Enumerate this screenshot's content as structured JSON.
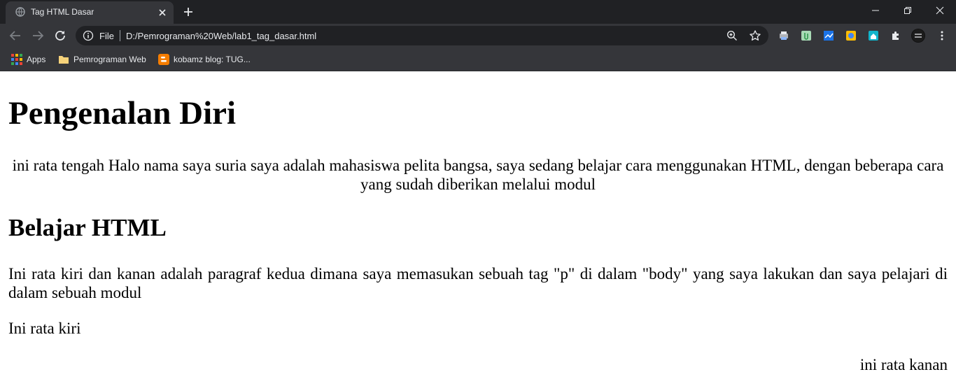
{
  "browser": {
    "tab": {
      "title": "Tag HTML Dasar"
    },
    "omnibox": {
      "scheme_label": "File",
      "url": "D:/Pemrograman%20Web/lab1_tag_dasar.html"
    },
    "bookmarks": [
      {
        "label": "Apps",
        "icon": "apps-grid-icon"
      },
      {
        "label": "Pemrograman Web",
        "icon": "folder-icon"
      },
      {
        "label": "kobamz blog: TUG...",
        "icon": "blogger-icon"
      }
    ],
    "colors": {
      "titlebar": "#202124",
      "toolbar": "#35363a",
      "text": "#e8eaed",
      "folder": "#f5d27a",
      "blogger": "#f57d00"
    }
  },
  "page": {
    "heading1": "Pengenalan Diri",
    "paragraph_center": "ini rata tengah Halo nama saya suria saya adalah mahasiswa pelita bangsa, saya sedang belajar cara menggunakan HTML, dengan beberapa cara yang sudah diberikan melalui modul",
    "heading2": "Belajar HTML",
    "paragraph_justify": "Ini rata kiri dan kanan adalah paragraf kedua dimana saya memasukan sebuah tag \"p\" di dalam \"body\" yang saya lakukan dan saya pelajari di dalam sebuah modul",
    "paragraph_left": "Ini rata kiri",
    "paragraph_right": "ini rata kanan"
  }
}
